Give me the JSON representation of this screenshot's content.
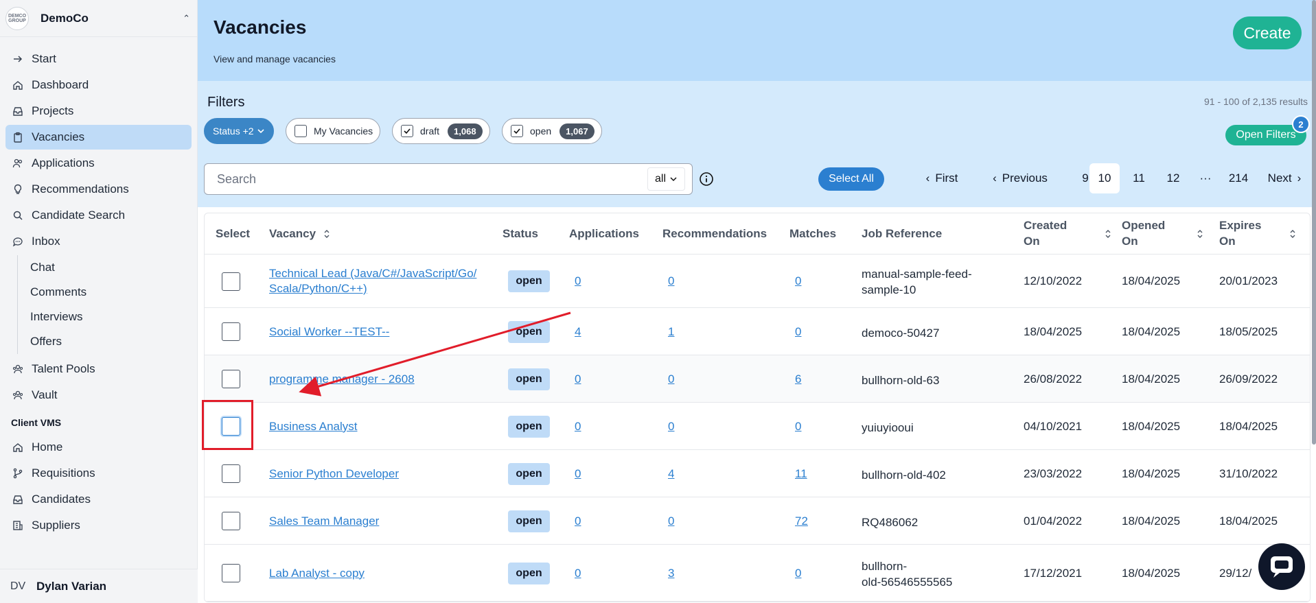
{
  "org": {
    "logo_text": "DEMCO GROUP",
    "name": "DemoCo"
  },
  "nav": [
    {
      "label": "Start",
      "icon": "arrow-right-icon"
    },
    {
      "label": "Dashboard",
      "icon": "home-icon"
    },
    {
      "label": "Projects",
      "icon": "inbox-tray-icon"
    },
    {
      "label": "Vacancies",
      "icon": "clipboard-icon",
      "active": true
    },
    {
      "label": "Applications",
      "icon": "users-icon"
    },
    {
      "label": "Recommendations",
      "icon": "lightbulb-icon"
    },
    {
      "label": "Candidate Search",
      "icon": "search-icon"
    },
    {
      "label": "Inbox",
      "icon": "chat-bubble-icon"
    }
  ],
  "inbox_sub": [
    "Chat",
    "Comments",
    "Interviews",
    "Offers"
  ],
  "nav2": [
    {
      "label": "Talent Pools",
      "icon": "users-group-icon"
    },
    {
      "label": "Vault",
      "icon": "users-group-icon"
    }
  ],
  "section_label": "Client VMS",
  "nav3": [
    {
      "label": "Home",
      "icon": "home-icon"
    },
    {
      "label": "Requisitions",
      "icon": "branch-icon"
    },
    {
      "label": "Candidates",
      "icon": "inbox-tray-icon"
    },
    {
      "label": "Suppliers",
      "icon": "building-icon"
    }
  ],
  "user": {
    "initials": "DV",
    "name": "Dylan Varian"
  },
  "header": {
    "title": "Vacancies",
    "subtitle": "View and manage vacancies",
    "create_label": "Create"
  },
  "filters": {
    "title": "Filters",
    "results": "91 - 100 of 2,135 results",
    "status_chip": "Status +2",
    "my_vacancies": "My Vacancies",
    "draft_label": "draft",
    "draft_count": "1,068",
    "open_label": "open",
    "open_count": "1,067",
    "open_filters_label": "Open Filters",
    "open_filters_count": "2"
  },
  "search": {
    "placeholder": "Search",
    "scope": "all"
  },
  "select_all_label": "Select All",
  "pagination": {
    "first": "First",
    "previous": "Previous",
    "pages": [
      "9",
      "10",
      "11",
      "12"
    ],
    "current": "10",
    "ellipsis": "···",
    "last": "214",
    "next": "Next"
  },
  "table": {
    "headers": {
      "select": "Select",
      "vacancy": "Vacancy",
      "status": "Status",
      "applications": "Applications",
      "recommendations": "Recommendations",
      "matches": "Matches",
      "job_reference": "Job Reference",
      "created_1": "Created",
      "created_2": "On",
      "opened_1": "Opened",
      "opened_2": "On",
      "expires_1": "Expires",
      "expires_2": "On"
    },
    "rows": [
      {
        "vacancy_1": "Technical Lead (Java/C#/JavaScript/Go/",
        "vacancy_2": "Scala/Python/C++)",
        "status": "open",
        "applications": "0",
        "recommendations": "0",
        "matches": "0",
        "ref_1": "manual-sample-feed-",
        "ref_2": "sample-10",
        "created": "12/10/2022",
        "opened": "18/04/2025",
        "expires": "20/01/2023"
      },
      {
        "vacancy_1": "Social Worker --TEST--",
        "vacancy_2": "",
        "status": "open",
        "applications": "4",
        "recommendations": "1",
        "matches": "0",
        "ref_1": "democo-50427",
        "ref_2": "",
        "created": "18/04/2025",
        "opened": "18/04/2025",
        "expires": "18/05/2025"
      },
      {
        "vacancy_1": "programme manager - 2608",
        "vacancy_2": "",
        "status": "open",
        "applications": "0",
        "recommendations": "0",
        "matches": "6",
        "ref_1": "bullhorn-old-63",
        "ref_2": "",
        "created": "26/08/2022",
        "opened": "18/04/2025",
        "expires": "26/09/2022"
      },
      {
        "vacancy_1": "Business Analyst",
        "vacancy_2": "",
        "status": "open",
        "applications": "0",
        "recommendations": "0",
        "matches": "0",
        "ref_1": "yuiuyiooui",
        "ref_2": "",
        "created": "04/10/2021",
        "opened": "18/04/2025",
        "expires": "18/04/2025"
      },
      {
        "vacancy_1": "Senior Python Developer",
        "vacancy_2": "",
        "status": "open",
        "applications": "0",
        "recommendations": "4",
        "matches": "11",
        "ref_1": "bullhorn-old-402",
        "ref_2": "",
        "created": "23/03/2022",
        "opened": "18/04/2025",
        "expires": "31/10/2022"
      },
      {
        "vacancy_1": "Sales Team Manager",
        "vacancy_2": "",
        "status": "open",
        "applications": "0",
        "recommendations": "0",
        "matches": "72",
        "ref_1": "RQ486062",
        "ref_2": "",
        "created": "01/04/2022",
        "opened": "18/04/2025",
        "expires": "18/04/2025"
      },
      {
        "vacancy_1": "Lab Analyst - copy",
        "vacancy_2": "",
        "status": "open",
        "applications": "0",
        "recommendations": "3",
        "matches": "0",
        "ref_1": "bullhorn-",
        "ref_2": "old-56546555565",
        "created": "17/12/2021",
        "opened": "18/04/2025",
        "expires": "29/12/"
      }
    ]
  },
  "colors": {
    "accent": "#1fb394",
    "link": "#2b7fd0",
    "header_bg": "#b8dcfb",
    "annotation": "#e11d2a"
  }
}
